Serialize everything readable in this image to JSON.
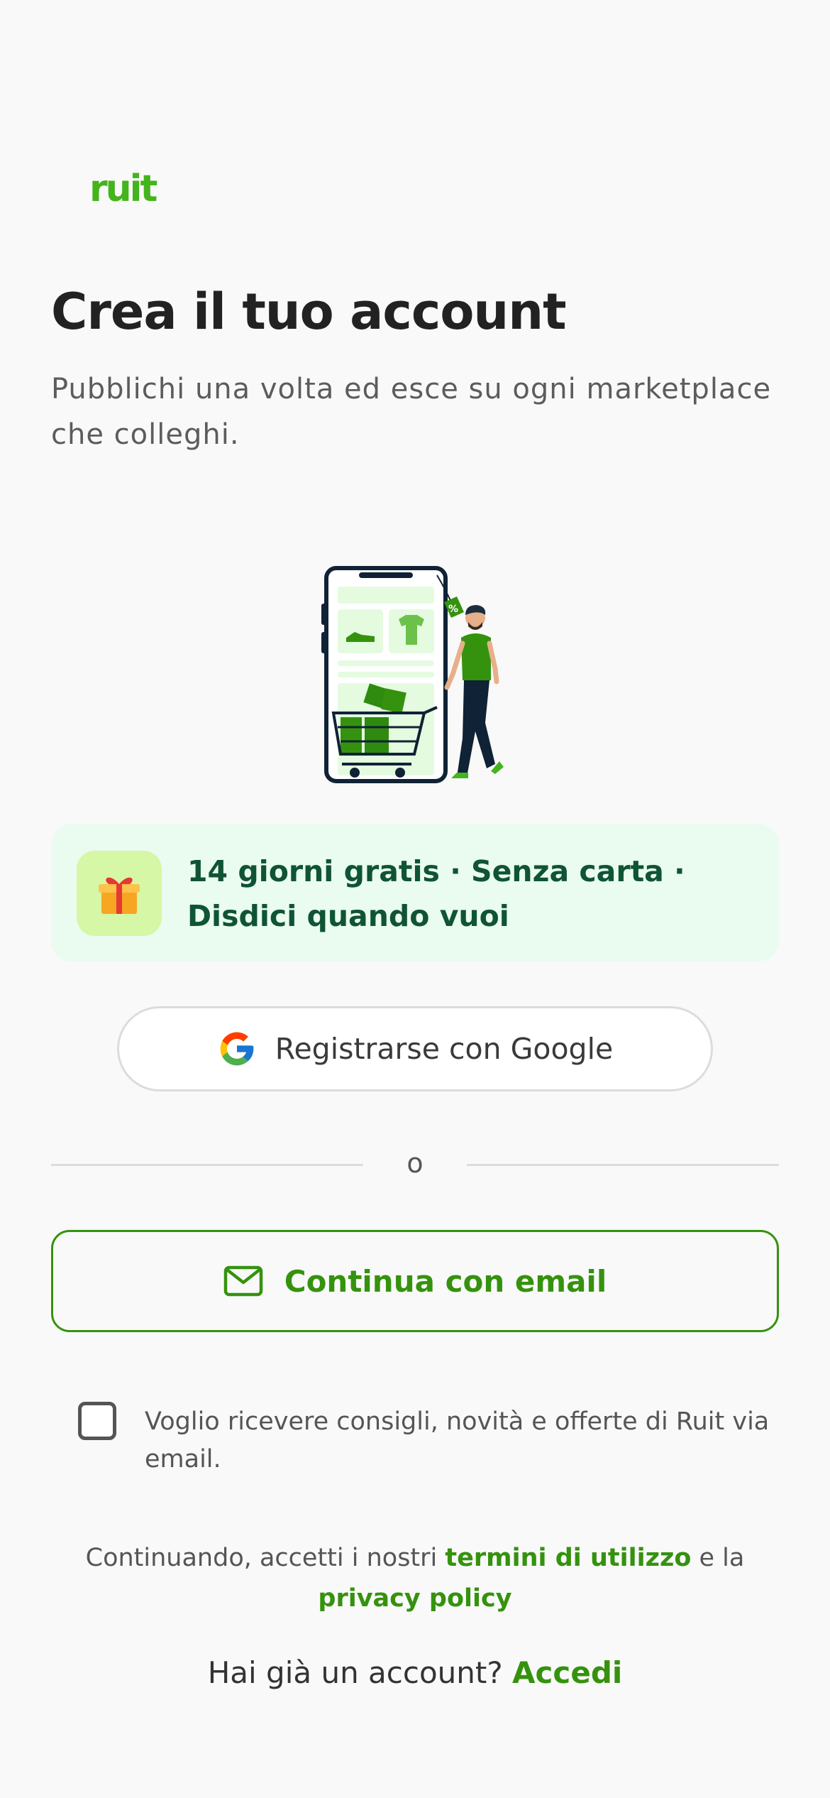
{
  "brand": {
    "logo_text": "ruit",
    "accent_color": "#44b41c",
    "link_color": "#35920e"
  },
  "header": {
    "title": "Crea il tuo account",
    "subtitle": "Pubblichi una volta ed esce su ogni marketplace che colleghi."
  },
  "promo": {
    "icon": "gift-icon",
    "text": "14 giorni gratis · Senza carta · Disdici quando vuoi"
  },
  "google_button": {
    "icon": "google-icon",
    "label": "Registrarse con Google"
  },
  "divider": {
    "text": "o"
  },
  "email_button": {
    "icon": "mail-icon",
    "label": "Continua con email"
  },
  "marketing_consent": {
    "checked": false,
    "label": "Voglio ricevere consigli, novità e offerte di Ruit via email."
  },
  "terms": {
    "prefix": "Continuando, accetti i nostri",
    "terms_link": "termini di utilizzo",
    "joiner": "e la",
    "privacy_link": "privacy policy"
  },
  "login": {
    "prompt": "Hai già un account?",
    "link": "Accedi"
  }
}
